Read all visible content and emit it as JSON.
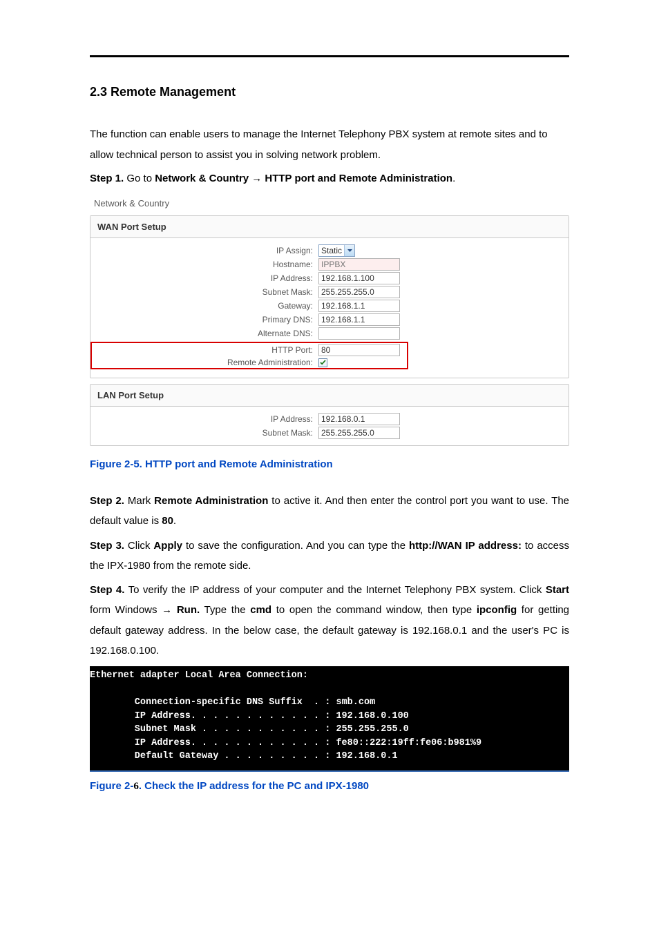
{
  "section": {
    "title": "2.3 Remote Management",
    "intro": "The function can enable users to manage the Internet Telephony PBX system at remote sites and to allow technical person to assist you in solving network problem.",
    "step1_prefix": "Step 1.",
    "step1_text_a": " Go to ",
    "step1_bold": "Network & Country → HTTP port and Remote Administration",
    "step1_text_b": "."
  },
  "breadcrumb": "Network & Country",
  "wan": {
    "title": "WAN Port Setup",
    "labels": {
      "ip_assign": "IP Assign:",
      "hostname": "Hostname:",
      "ip_address": "IP Address:",
      "subnet_mask": "Subnet Mask:",
      "gateway": "Gateway:",
      "primary_dns": "Primary DNS:",
      "alternate_dns": "Alternate DNS:",
      "http_port": "HTTP Port:",
      "remote_admin": "Remote Administration:"
    },
    "values": {
      "ip_assign_selected": "Static",
      "hostname_placeholder": "IPPBX",
      "ip_address": "192.168.1.100",
      "subnet_mask": "255.255.255.0",
      "gateway": "192.168.1.1",
      "primary_dns": "192.168.1.1",
      "alternate_dns": "",
      "http_port": "80",
      "remote_admin_checked": true
    }
  },
  "lan": {
    "title": "LAN Port Setup",
    "labels": {
      "ip_address": "IP Address:",
      "subnet_mask": "Subnet Mask:"
    },
    "values": {
      "ip_address": "192.168.0.1",
      "subnet_mask": "255.255.255.0"
    }
  },
  "figure25": "Figure 2-5. HTTP port and Remote Administration",
  "steps": {
    "s2_label": "Step 2.",
    "s2_a": " Mark ",
    "s2_b": "Remote Administration",
    "s2_c": " to active it. And then enter the control port you want to use. The default value is ",
    "s2_d": "80",
    "s2_e": ".",
    "s3_label": "Step 3.",
    "s3_a": " Click ",
    "s3_b": "Apply",
    "s3_c": " to save the configuration. And you can type the ",
    "s3_d": "http://WAN IP address:",
    "s3_e": " to access the IPX-1980 from the remote side.",
    "s4_label": "Step 4.",
    "s4_a": " To verify the IP address of your computer and the Internet Telephony PBX system. Click ",
    "s4_b": "Start",
    "s4_c": " form Windows → ",
    "s4_d": "Run.",
    "s4_e": " Type the ",
    "s4_f": "cmd",
    "s4_g": " to open the command window, then type ",
    "s4_h": "ipconfig",
    "s4_i": " for getting default gateway address. In the below case, the default gateway is 192.168.0.1 and the user's PC is 192.168.0.100."
  },
  "terminal_lines": [
    "Ethernet adapter Local Area Connection:",
    "",
    "        Connection-specific DNS Suffix  . : smb.com",
    "        IP Address. . . . . . . . . . . . : 192.168.0.100",
    "        Subnet Mask . . . . . . . . . . . : 255.255.255.0",
    "        IP Address. . . . . . . . . . . . : fe80::222:19ff:fe06:b981%9",
    "        Default Gateway . . . . . . . . . : 192.168.0.1"
  ],
  "figure26_a": "Figure 2-",
  "figure26_num": "6",
  "figure26_b": ". Check the IP address for the PC and IPX-1980"
}
